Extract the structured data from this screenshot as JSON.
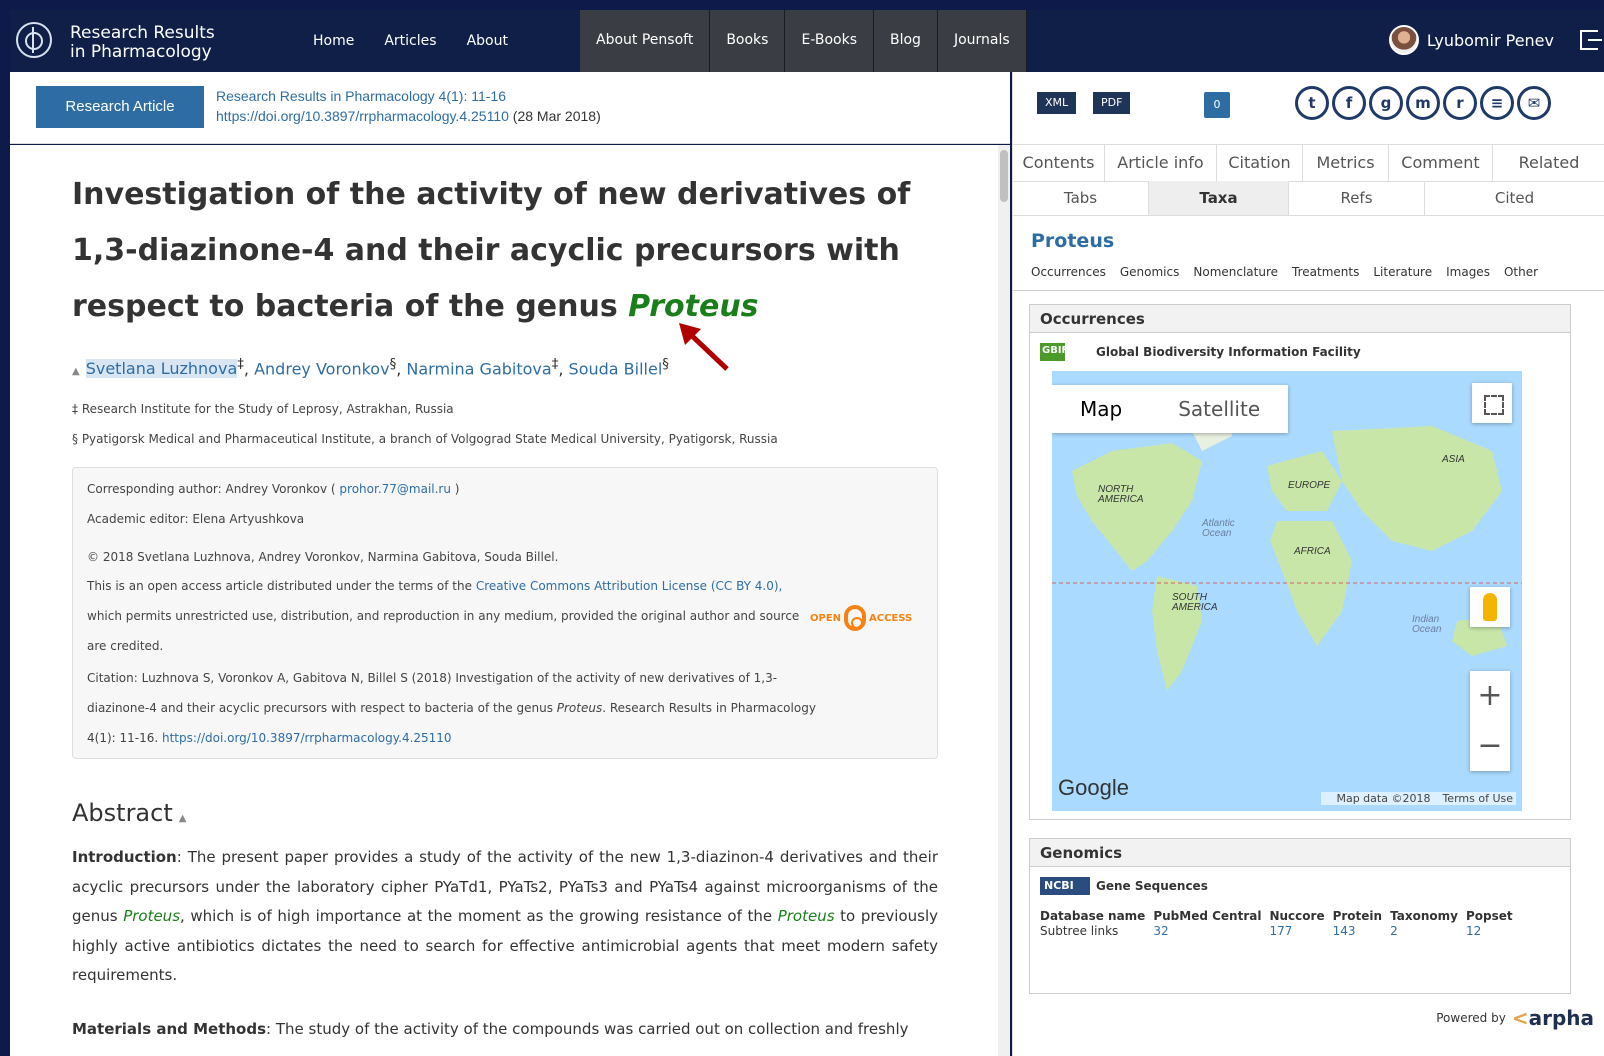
{
  "site": {
    "title_line1": "Research Results",
    "title_line2": "in Pharmacology",
    "nav": [
      "Home",
      "Articles",
      "About"
    ],
    "nav2": [
      "About Pensoft",
      "Books",
      "E-Books",
      "Blog",
      "Journals"
    ],
    "user": "Lyubomir Penev"
  },
  "article": {
    "type": "Research Article",
    "journal_ref": "Research Results in Pharmacology 4(1): 11-16",
    "doi": "https://doi.org/10.3897/rrpharmacology.4.25110",
    "date": " (28 Mar 2018)",
    "title_l1": "Investigation of the activity of new derivatives of",
    "title_l2": "1,3-diazinone-4 and their acyclic precursors with",
    "title_l3": "respect to bacteria of the genus ",
    "title_genus": "Proteus",
    "authors": [
      {
        "name": "Svetlana Luzhnova",
        "sup": "‡"
      },
      {
        "name": "Andrey Voronkov",
        "sup": "§"
      },
      {
        "name": "Narmina Gabitova",
        "sup": "‡"
      },
      {
        "name": "Souda Billel",
        "sup": "§"
      }
    ],
    "affil1": "‡ Research Institute for the Study of Leprosy, Astrakhan, Russia",
    "affil2": "§ Pyatigorsk Medical and Pharmaceutical Institute, a branch of Volgograd State Medical University, Pyatigorsk, Russia"
  },
  "infobox": {
    "corr_prefix": "Corresponding author: Andrey Voronkov ( ",
    "corr_email": "prohor.77@mail.ru",
    "corr_suffix": " )",
    "editor": "Academic editor: Elena Artyushkova",
    "copyright": "© 2018 Svetlana Luzhnova, Andrey Voronkov, Narmina Gabitova, Souda Billel.",
    "license_pre": "This is an open access article distributed under the terms of the ",
    "license_link": "Creative Commons Attribution License (CC BY 4.0),",
    "license_l2": "which permits unrestricted use, distribution, and reproduction in any medium, provided the original author and source",
    "license_l3": "are credited.",
    "oa_open": "OPEN",
    "oa_access": "ACCESS",
    "cite_l1": "Citation: Luzhnova S, Voronkov A, Gabitova N, Billel S (2018) Investigation of the activity of new derivatives of 1,3-",
    "cite_l2_pre": "diazinone-4 and their acyclic precursors with respect to bacteria of the genus ",
    "cite_l2_genus": "Proteus",
    "cite_l2_post": ". Research Results in Pharmacology",
    "cite_l3_pre": "4(1): 11-16. ",
    "cite_l3_doi": "https://doi.org/10.3897/rrpharmacology.4.25110"
  },
  "abstract": {
    "heading": "Abstract",
    "intro_label": "Introduction",
    "intro_a": ": The present paper provides a study of the activity of the new 1,3-diazinon-4 derivatives and their acyclic precursors under the laboratory cipher PYaTd1, PYaTs2, PYaTs3 and PYaTs4 against microorganisms of the genus ",
    "intro_genus1": "Proteus",
    "intro_b": ", which is of high importance at the moment as the growing resistance of the ",
    "intro_genus2": "Proteus",
    "intro_c": " to previously highly active antibiotics dictates the need to search for effective antimicrobial agents that meet modern safety requirements.",
    "mm_label": "Materials and Methods",
    "mm_text": ": The study of the activity of the compounds was carried out on collection and freshly"
  },
  "rpanel": {
    "xml": "XML",
    "pdf": "PDF",
    "count": "0",
    "tabs1": [
      "Contents",
      "Article info",
      "Citation",
      "Metrics",
      "Comment",
      "Related"
    ],
    "tabs2": [
      "Tabs",
      "Taxa",
      "Refs",
      "Cited"
    ],
    "taxon": "Proteus",
    "subnav": [
      "Occurrences",
      "Genomics",
      "Nomenclature",
      "Treatments",
      "Literature",
      "Images",
      "Other"
    ],
    "occ_heading": "Occurrences",
    "gbif_label": "Global Biodiversity Information Facility",
    "map_btn": "Map",
    "sat_btn": "Satellite",
    "google": "Google",
    "map_data": "Map data ©2018",
    "terms": "Terms of Use",
    "labels": {
      "north": "NORTH",
      "america": "AMERICA",
      "europe": "EUROPE",
      "asia": "ASIA",
      "africa": "AFRICA",
      "south": "SOUTH",
      "samerica": "AMERICA",
      "atlantic": "Atlantic",
      "ocean": "Ocean",
      "indian": "Indian",
      "ocean2": "Ocean"
    },
    "gen_heading": "Genomics",
    "ncbi_label": "Gene Sequences",
    "table_headers": [
      "Database name",
      "PubMed Central",
      "Nuccore",
      "Protein",
      "Taxonomy",
      "Popset"
    ],
    "table_row": [
      "Subtree links",
      "32",
      "177",
      "143",
      "2",
      "12"
    ],
    "powered": "Powered by",
    "arpha": "arpha"
  }
}
